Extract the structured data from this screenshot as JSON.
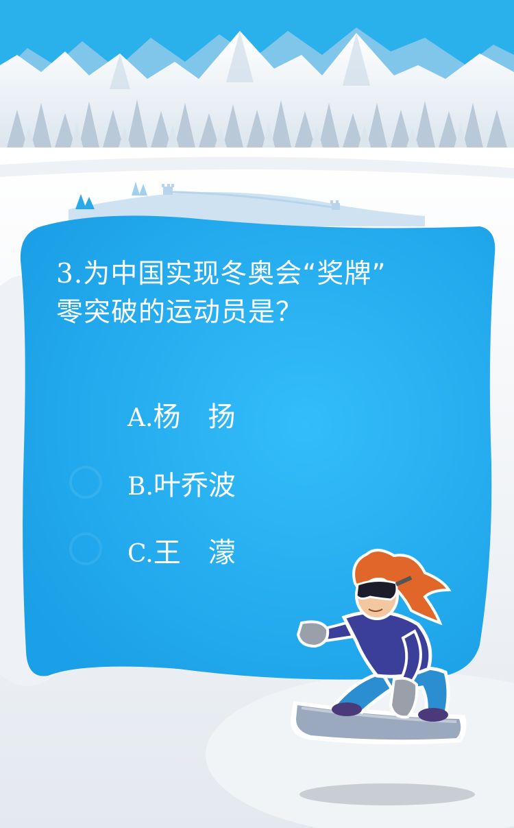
{
  "quiz": {
    "question_number": "3.",
    "question_line1": "为中国实现冬奥会“奖牌”",
    "question_line2": "零突破的运动员是？",
    "options": [
      {
        "letter": "A.",
        "name": "杨　扬"
      },
      {
        "letter": "B.",
        "name": "叶乔波"
      },
      {
        "letter": "C.",
        "name": "王　濛"
      }
    ]
  },
  "colors": {
    "sky": "#2ab0ea",
    "card": "#22a8f0",
    "snow": "#ffffff",
    "hair": "#e0662a",
    "jacket": "#3c3f9a",
    "pants": "#2a8ed0",
    "board": "#9aa9bd"
  },
  "icons": [
    "mountain-range-illustration",
    "pine-forest-illustration",
    "great-wall-illustration",
    "snowboarder-illustration"
  ]
}
